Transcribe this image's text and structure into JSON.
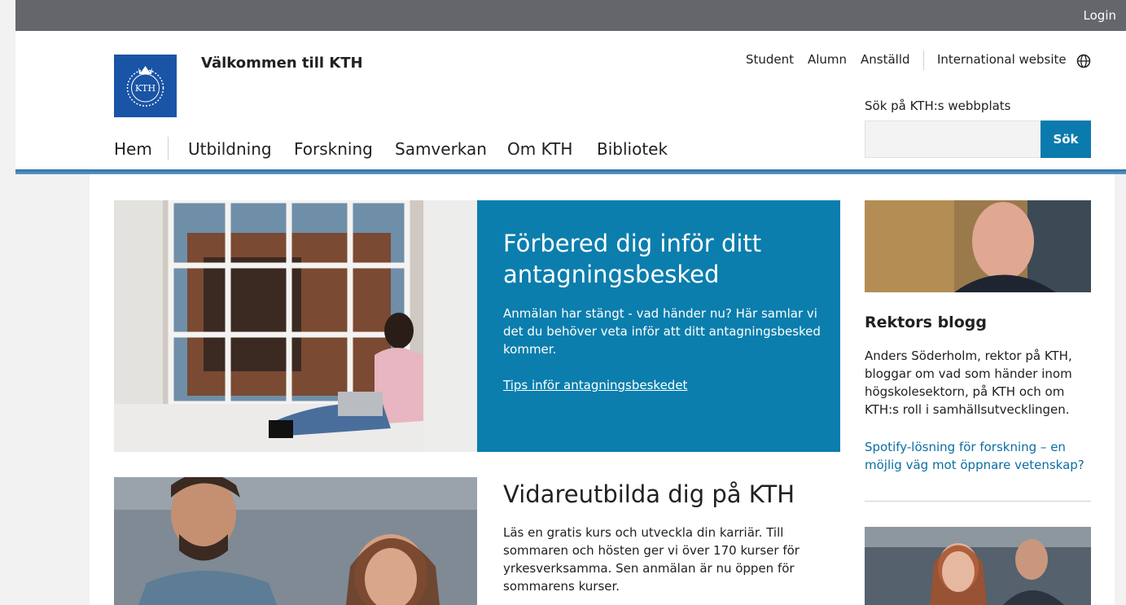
{
  "topbar": {
    "login_label": "Login"
  },
  "header": {
    "logo_text": "KTH",
    "site_title": "Välkommen till KTH",
    "topnav": [
      "Student",
      "Alumn",
      "Anställd",
      "International website"
    ],
    "search_label": "Sök på KTH:s webbplats",
    "search_value": "",
    "search_button": "Sök",
    "mainnav": [
      "Hem",
      "Utbildning",
      "Forskning",
      "Samverkan",
      "Om KTH",
      "Bibliotek"
    ]
  },
  "hero1": {
    "title": "Förbered dig inför ditt antagningsbesked",
    "text": "Anmälan har stängt - vad händer nu? Här samlar vi det du behöver veta inför att ditt antagningsbesked kommer.",
    "link": "Tips inför antagningsbeskedet"
  },
  "hero2": {
    "title": "Vidareutbilda dig på KTH",
    "text": "Läs en gratis kurs och utveckla din karriär. Till sommaren och hösten ger vi över 170 kurser för yrkesverksamma. Sen anmälan är nu öppen för sommarens kurser."
  },
  "blog": {
    "title": "Rektors blogg",
    "text": "Anders Söderholm, rektor på KTH, bloggar om vad som händer inom högskolesektorn, på KTH och om KTH:s roll i samhällsutvecklingen.",
    "link": "Spotify-lösning för forskning – en möjlig väg mot öppnare vetenskap?"
  },
  "colors": {
    "brand_blue": "#1954a6",
    "accent": "#0b7ead",
    "link": "#0b6ea3",
    "topbar": "#65656c"
  },
  "icons": [
    "globe-icon",
    "kth-logo"
  ]
}
